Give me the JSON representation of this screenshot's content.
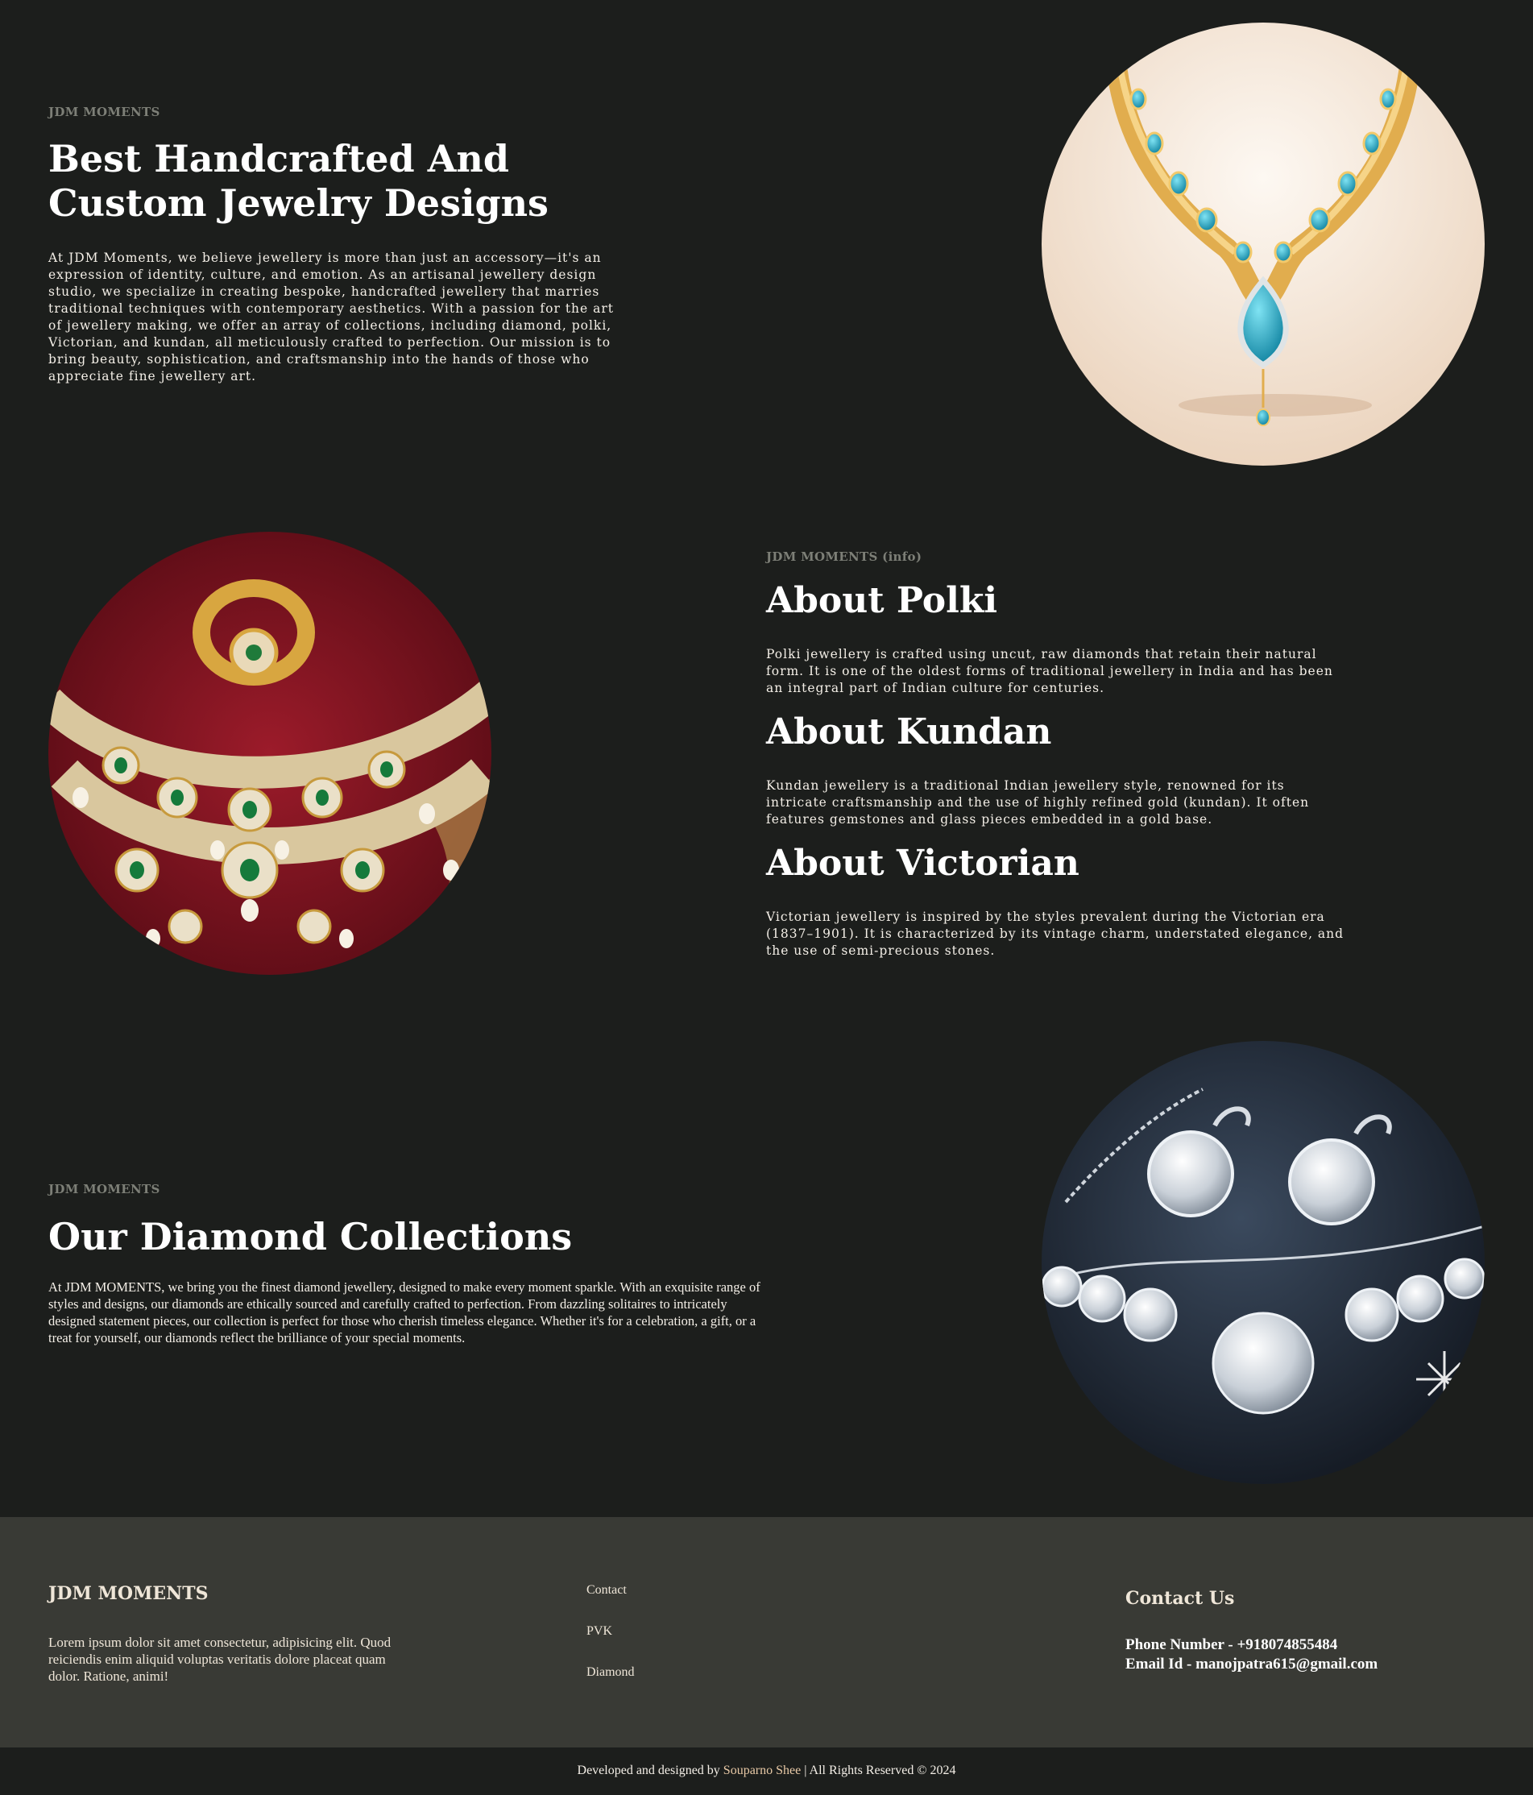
{
  "hero": {
    "eyebrow": "JDM MOMENTS",
    "title_line1": "Best Handcrafted And",
    "title_line2": "Custom Jewelry Designs",
    "description": "At JDM Moments, we believe jewellery is more than just an accessory—it's an expression of identity, culture, and emotion. As an artisanal jewellery design studio, we specialize in creating bespoke, handcrafted jewellery that marries traditional techniques with contemporary aesthetics. With a passion for the art of jewellery making, we offer an array of collections, including diamond, polki, Victorian, and kundan, all meticulously crafted to perfection. Our mission is to bring beauty, sophistication, and craftsmanship into the hands of those who appreciate fine jewellery art.",
    "image_icon": "turquoise-necklace-image"
  },
  "info": {
    "eyebrow": "JDM MOMENTS (info)",
    "image_icon": "kundan-polki-jewellery-image",
    "sections": [
      {
        "title": "About Polki",
        "text": "Polki jewellery is crafted using uncut, raw diamonds that retain their natural form. It is one of the oldest forms of traditional jewellery in India and has been an integral part of Indian culture for centuries."
      },
      {
        "title": "About Kundan",
        "text": "Kundan jewellery is a traditional Indian jewellery style, renowned for its intricate craftsmanship and the use of highly refined gold (kundan). It often features gemstones and glass pieces embedded in a gold base."
      },
      {
        "title": "About Victorian",
        "text": "Victorian jewellery is inspired by the styles prevalent during the Victorian era (1837–1901). It is characterized by its vintage charm, understated elegance, and the use of semi-precious stones."
      }
    ]
  },
  "diamond": {
    "eyebrow": "JDM MOMENTS",
    "title": "Our Diamond Collections",
    "description": "At JDM MOMENTS, we bring you the finest diamond jewellery, designed to make every moment sparkle. With an exquisite range of styles and designs, our diamonds are ethically sourced and carefully crafted to perfection. From dazzling solitaires to intricately designed statement pieces, our collection is perfect for those who cherish timeless elegance. Whether it's for a celebration, a gift, or a treat for yourself, our diamonds reflect the brilliance of your special moments.",
    "image_icon": "diamond-earrings-necklace-image"
  },
  "footer": {
    "brand": "JDM MOMENTS",
    "blurb": "Lorem ipsum dolor sit amet consectetur, adipisicing elit. Quod reiciendis enim aliquid voluptas veritatis dolore placeat quam dolor. Ratione, animi!",
    "links": [
      "Contact",
      "PVK",
      "Diamond"
    ],
    "contact_title": "Contact Us",
    "phone": "Phone Number - +918074855484",
    "email": "Email Id - manojpatra615@gmail.com",
    "copyright_prefix": "Developed and designed by",
    "author": "Souparno Shee",
    "copyright_suffix": "| All Rights Reserved © 2024"
  },
  "colors": {
    "background": "#1c1e1c",
    "footer_background": "#393a35",
    "eyebrow": "#7d7f77",
    "author_accent": "#e8c9a6"
  }
}
